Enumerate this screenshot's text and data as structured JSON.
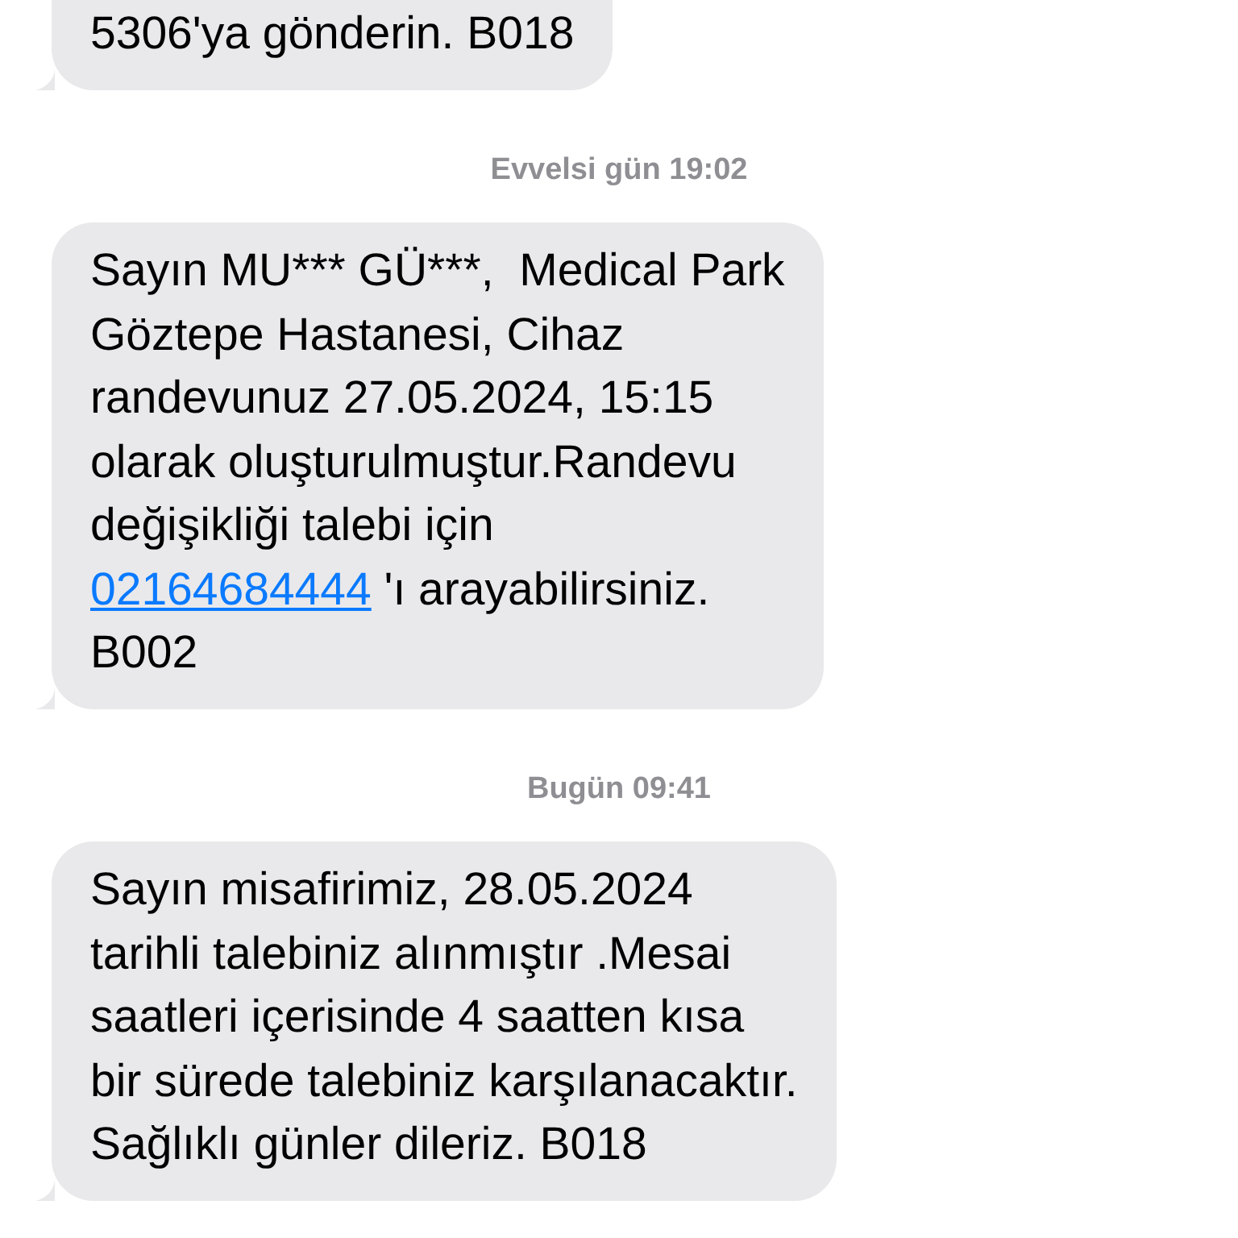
{
  "messages": [
    {
      "lines": [
        {
          "text": "5306'ya gönderin. B018"
        }
      ],
      "cut_top": true
    },
    {
      "timestamp": "Evvelsi gün 19:02",
      "lines": [
        {
          "text": "Sayın MU*** GÜ***,  Medical Park"
        },
        {
          "text": "Göztepe Hastanesi, Cihaz"
        },
        {
          "text": "randevunuz 27.05.2024, 15:15"
        },
        {
          "text": "olarak oluşturulmuştur.Randevu"
        },
        {
          "text": "değişikliği talebi için"
        },
        {
          "link": "02164684444",
          "text": " 'ı arayabilirsiniz."
        },
        {
          "text": "B002"
        }
      ],
      "cut_top": false
    },
    {
      "timestamp": "Bugün 09:41",
      "lines": [
        {
          "text": "Sayın misafirimiz, 28.05.2024"
        },
        {
          "text": "tarihli talebiniz alınmıştır .Mesai"
        },
        {
          "text": "saatleri içerisinde 4 saatten kısa"
        },
        {
          "text": "bir sürede talebiniz karşılanacaktır."
        },
        {
          "text": "Sağlıklı günler dileriz. B018"
        }
      ],
      "cut_top": false
    }
  ]
}
